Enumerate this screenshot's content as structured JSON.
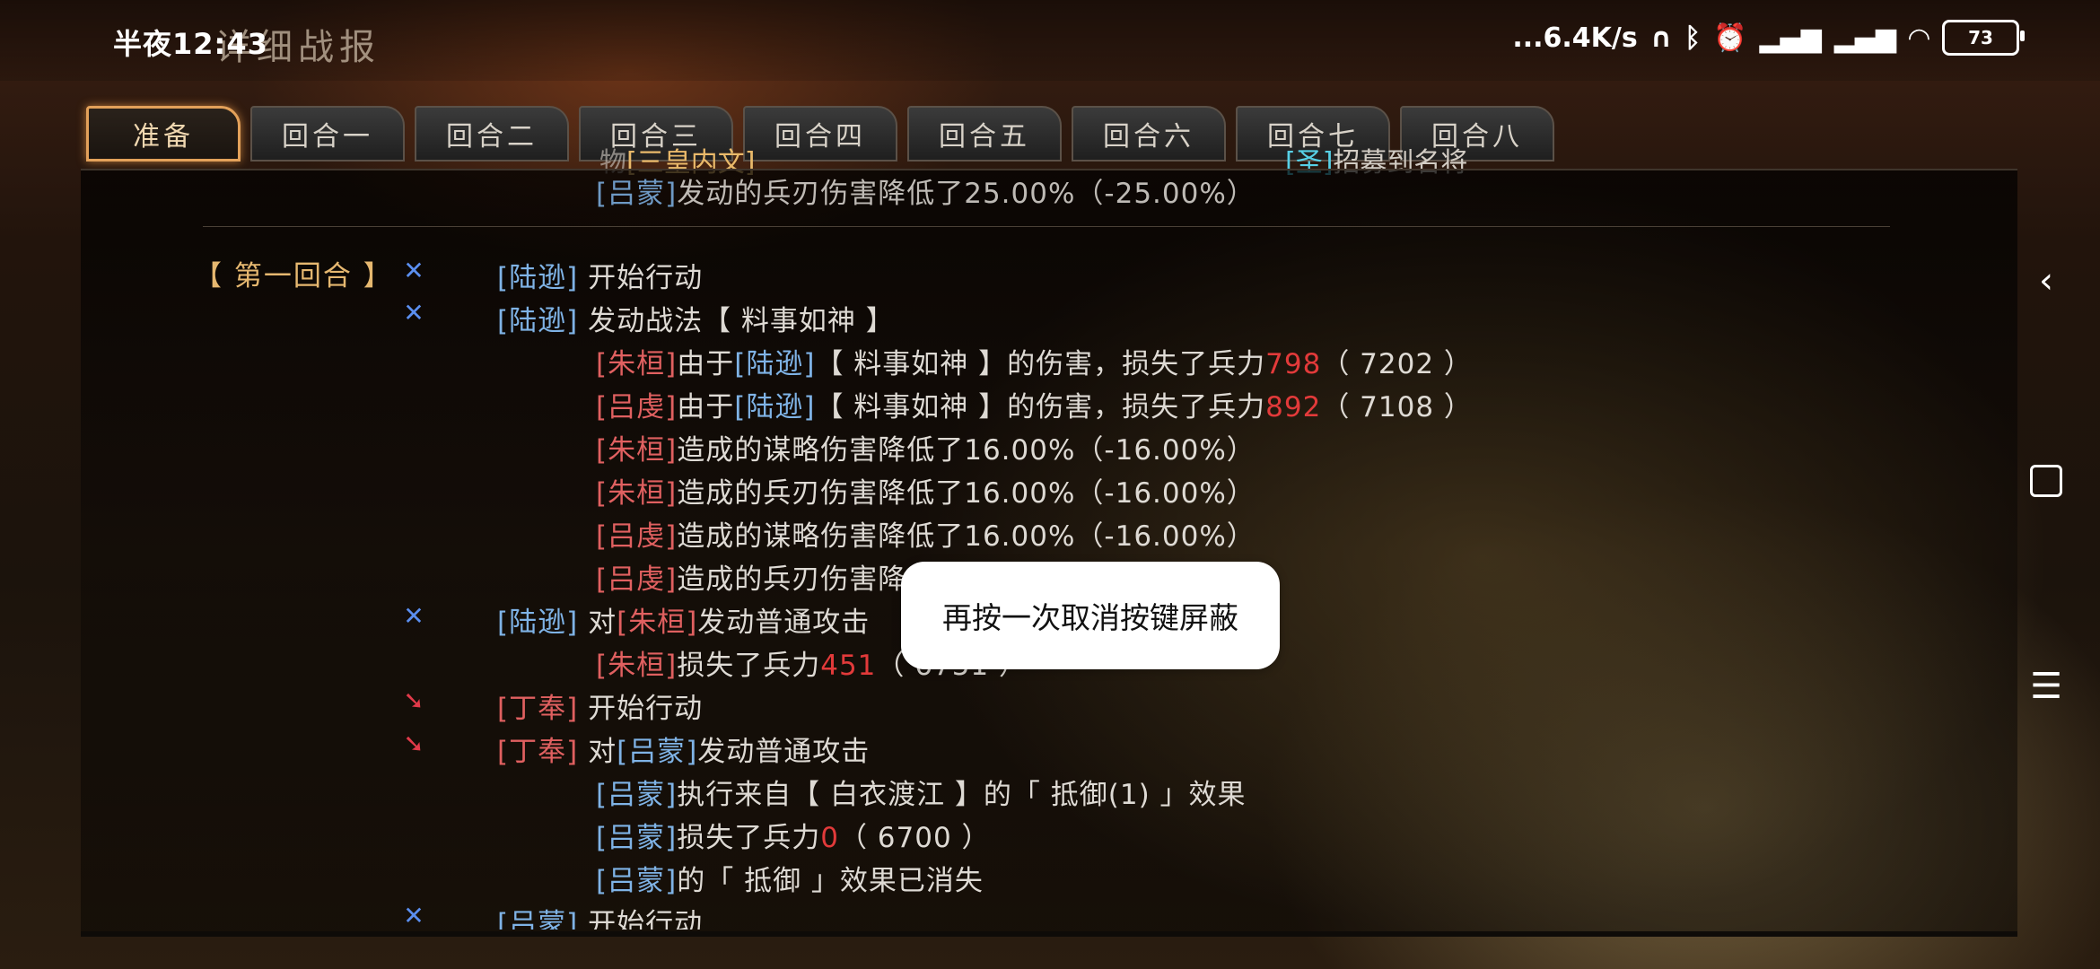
{
  "status_bar": {
    "time": "半夜12:43",
    "network_speed": "...6.4K/s",
    "battery": "73",
    "icons": [
      "headphones-icon",
      "bluetooth-icon",
      "alarm-icon",
      "signal-hd-icon",
      "signal-hd-icon",
      "wifi-icon",
      "battery-icon"
    ]
  },
  "page": {
    "title": "详细战报"
  },
  "tabs": [
    {
      "label": "准备",
      "active": true
    },
    {
      "label": "回合一"
    },
    {
      "label": "回合二"
    },
    {
      "label": "回合三"
    },
    {
      "label": "回合四"
    },
    {
      "label": "回合五"
    },
    {
      "label": "回合六"
    },
    {
      "label": "回合七"
    },
    {
      "label": "回合八"
    }
  ],
  "overlay": {
    "left_fragment_prefix": "物",
    "left_bracket_text": "三皇内文",
    "right_tag": "圣",
    "right_text": "招募到名将"
  },
  "report": {
    "prev_line": {
      "name": "吕蒙",
      "text": "发动的兵刃伤害降低了25.00%（-25.00%）"
    },
    "round_label": "【 第一回合 】",
    "lines": [
      {
        "icon": "sword-cross-icon",
        "actor": "陆逊",
        "text": "开始行动"
      },
      {
        "icon": "sword-cross-icon",
        "actor": "陆逊",
        "text": "发动战法【 料事如神 】"
      },
      {
        "sub": true,
        "target": "朱桓",
        "pre": "由于",
        "src": "陆逊",
        "mid": "【 料事如神 】的伤害，损失了兵力",
        "loss": "798",
        "remain": "（ 7202 ）"
      },
      {
        "sub": true,
        "target": "吕虔",
        "pre": "由于",
        "src": "陆逊",
        "mid": "【 料事如神 】的伤害，损失了兵力",
        "loss": "892",
        "remain": "（ 7108 ）"
      },
      {
        "sub": true,
        "target": "朱桓",
        "text": "造成的谋略伤害降低了16.00%（-16.00%）"
      },
      {
        "sub": true,
        "target": "朱桓",
        "text": "造成的兵刃伤害降低了16.00%（-16.00%）"
      },
      {
        "sub": true,
        "target": "吕虔",
        "text": "造成的谋略伤害降低了16.00%（-16.00%）"
      },
      {
        "sub": true,
        "target": "吕虔",
        "text": "造成的兵刃伤害降低了16.00%（-16.00%）"
      },
      {
        "icon": "sword-cross-icon",
        "actor": "陆逊",
        "pre": "对",
        "target": "朱桓",
        "text": "发动普通攻击"
      },
      {
        "sub": true,
        "target": "朱桓",
        "text": "损失了兵力",
        "loss": "451",
        "remain": "（ 6751 ）"
      },
      {
        "icon": "arrow-icon",
        "actor": "丁奉",
        "text": "开始行动"
      },
      {
        "icon": "arrow-icon",
        "actor": "丁奉",
        "pre": "对",
        "target": "吕蒙",
        "text": "发动普通攻击"
      },
      {
        "sub": true,
        "target": "吕蒙",
        "text": "执行来自【 白衣渡江 】的「 抵御(1) 」效果"
      },
      {
        "sub": true,
        "target": "吕蒙",
        "text": "损失了兵力",
        "loss": "0",
        "remain": "（ 6700 ）"
      },
      {
        "sub": true,
        "target": "吕蒙",
        "text": "的「 抵御 」效果已消失"
      },
      {
        "icon": "sword-cross-icon",
        "actor": "吕蒙",
        "text": "开始行动"
      }
    ]
  },
  "toast": {
    "text": "再按一次取消按键屏蔽"
  },
  "nav": {
    "back_icon": "back-icon",
    "home_icon": "home-icon",
    "menu_icon": "menu-icon"
  }
}
